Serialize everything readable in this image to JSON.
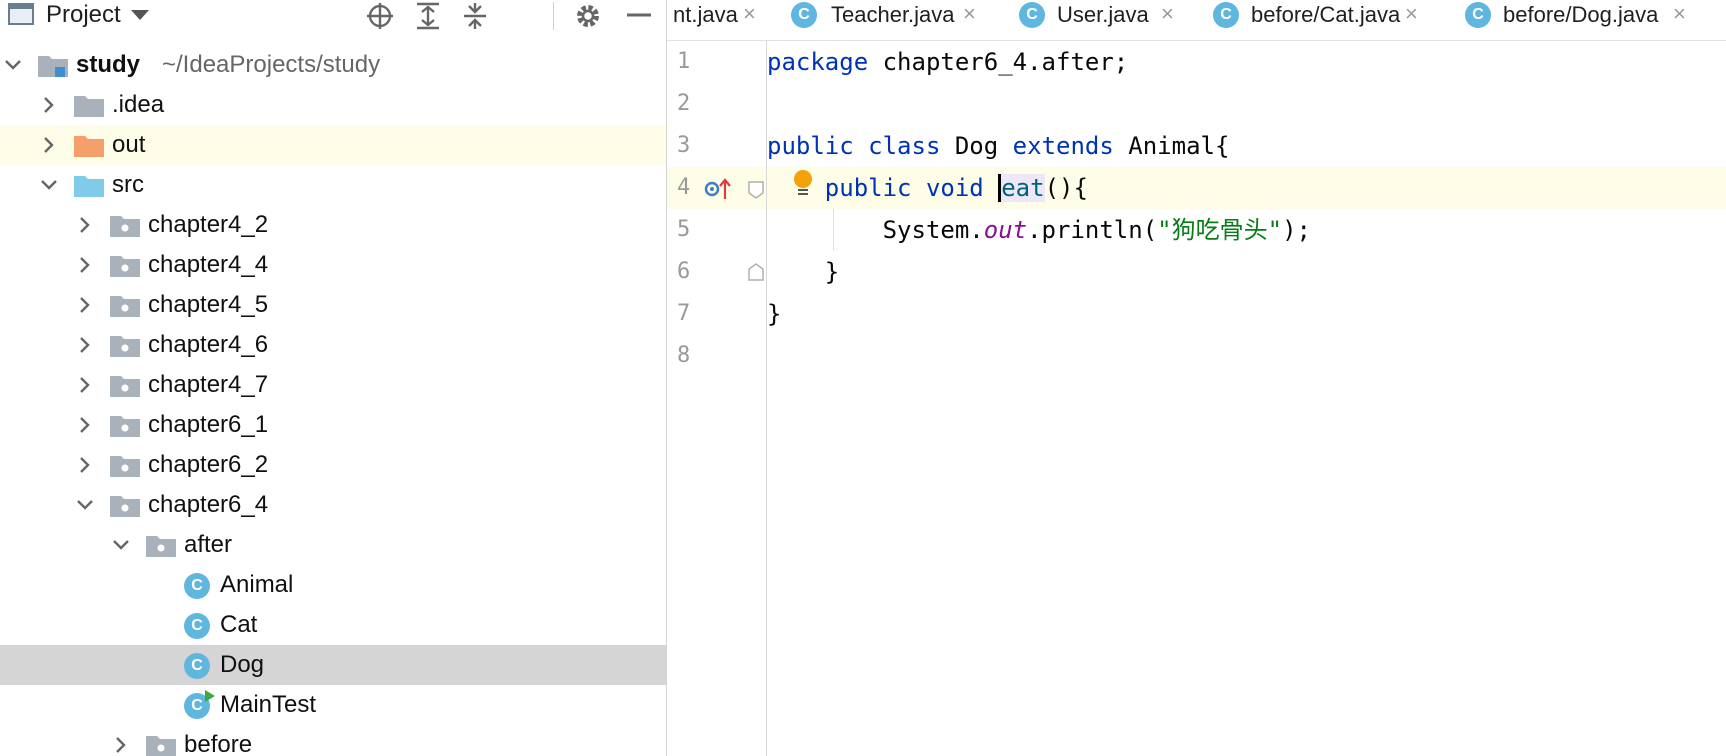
{
  "project_panel": {
    "title": "Project",
    "tree": [
      {
        "label": "study",
        "path": "~/IdeaProjects/study",
        "level": 0,
        "expanded": true,
        "icon": "module-folder-icon"
      },
      {
        "label": ".idea",
        "level": 1,
        "expanded": false,
        "icon": "folder-icon"
      },
      {
        "label": "out",
        "level": 1,
        "expanded": false,
        "icon": "excluded-folder-icon"
      },
      {
        "label": "src",
        "level": 1,
        "expanded": true,
        "icon": "source-folder-icon"
      },
      {
        "label": "chapter4_2",
        "level": 2,
        "expanded": false,
        "icon": "package-icon"
      },
      {
        "label": "chapter4_4",
        "level": 2,
        "expanded": false,
        "icon": "package-icon"
      },
      {
        "label": "chapter4_5",
        "level": 2,
        "expanded": false,
        "icon": "package-icon"
      },
      {
        "label": "chapter4_6",
        "level": 2,
        "expanded": false,
        "icon": "package-icon"
      },
      {
        "label": "chapter4_7",
        "level": 2,
        "expanded": false,
        "icon": "package-icon"
      },
      {
        "label": "chapter6_1",
        "level": 2,
        "expanded": false,
        "icon": "package-icon"
      },
      {
        "label": "chapter6_2",
        "level": 2,
        "expanded": false,
        "icon": "package-icon"
      },
      {
        "label": "chapter6_4",
        "level": 2,
        "expanded": true,
        "icon": "package-icon"
      },
      {
        "label": "after",
        "level": 3,
        "expanded": true,
        "icon": "package-icon"
      },
      {
        "label": "Animal",
        "level": 4,
        "icon": "class-icon"
      },
      {
        "label": "Cat",
        "level": 4,
        "icon": "class-icon"
      },
      {
        "label": "Dog",
        "level": 4,
        "icon": "class-icon",
        "selected": true
      },
      {
        "label": "MainTest",
        "level": 4,
        "icon": "runnable-class-icon"
      },
      {
        "label": "before",
        "level": 3,
        "expanded": false,
        "icon": "package-icon"
      }
    ]
  },
  "tabs": [
    {
      "label": "nt.java",
      "close": "×"
    },
    {
      "label": "Teacher.java",
      "icon_letter": "C",
      "close": "×"
    },
    {
      "label": "User.java",
      "icon_letter": "C",
      "close": "×"
    },
    {
      "label": "before/Cat.java",
      "icon_letter": "C",
      "close": "×"
    },
    {
      "label": "before/Dog.java",
      "icon_letter": "C",
      "close": "×"
    }
  ],
  "editor": {
    "line_numbers": [
      "1",
      "2",
      "3",
      "4",
      "5",
      "6",
      "7",
      "8"
    ],
    "lines": [
      {
        "kw1": "package",
        "rest": " chapter6_4.after;"
      },
      {},
      {
        "kw1": "public",
        "kw2": "class",
        "name": "Dog",
        "kw3": "extends",
        "rest": "Animal{"
      },
      {
        "indent": "    ",
        "kw1": "public",
        "kw2": "void",
        "fn": "eat",
        "rest": "(){"
      },
      {
        "indent": "        ",
        "obj": "System.",
        "fld": "out",
        "mid": ".println(",
        "str": "\"狗吃骨头\"",
        "rest": ");"
      },
      {
        "rest": "    }"
      },
      {
        "rest": "}"
      },
      {}
    ]
  },
  "colors": {
    "keyword": "#0033b3",
    "string": "#067d17",
    "field": "#871094",
    "selected_row": "#d5d5d5",
    "highlight_row": "#fdfde8",
    "class_icon": "#5fb7e0"
  }
}
